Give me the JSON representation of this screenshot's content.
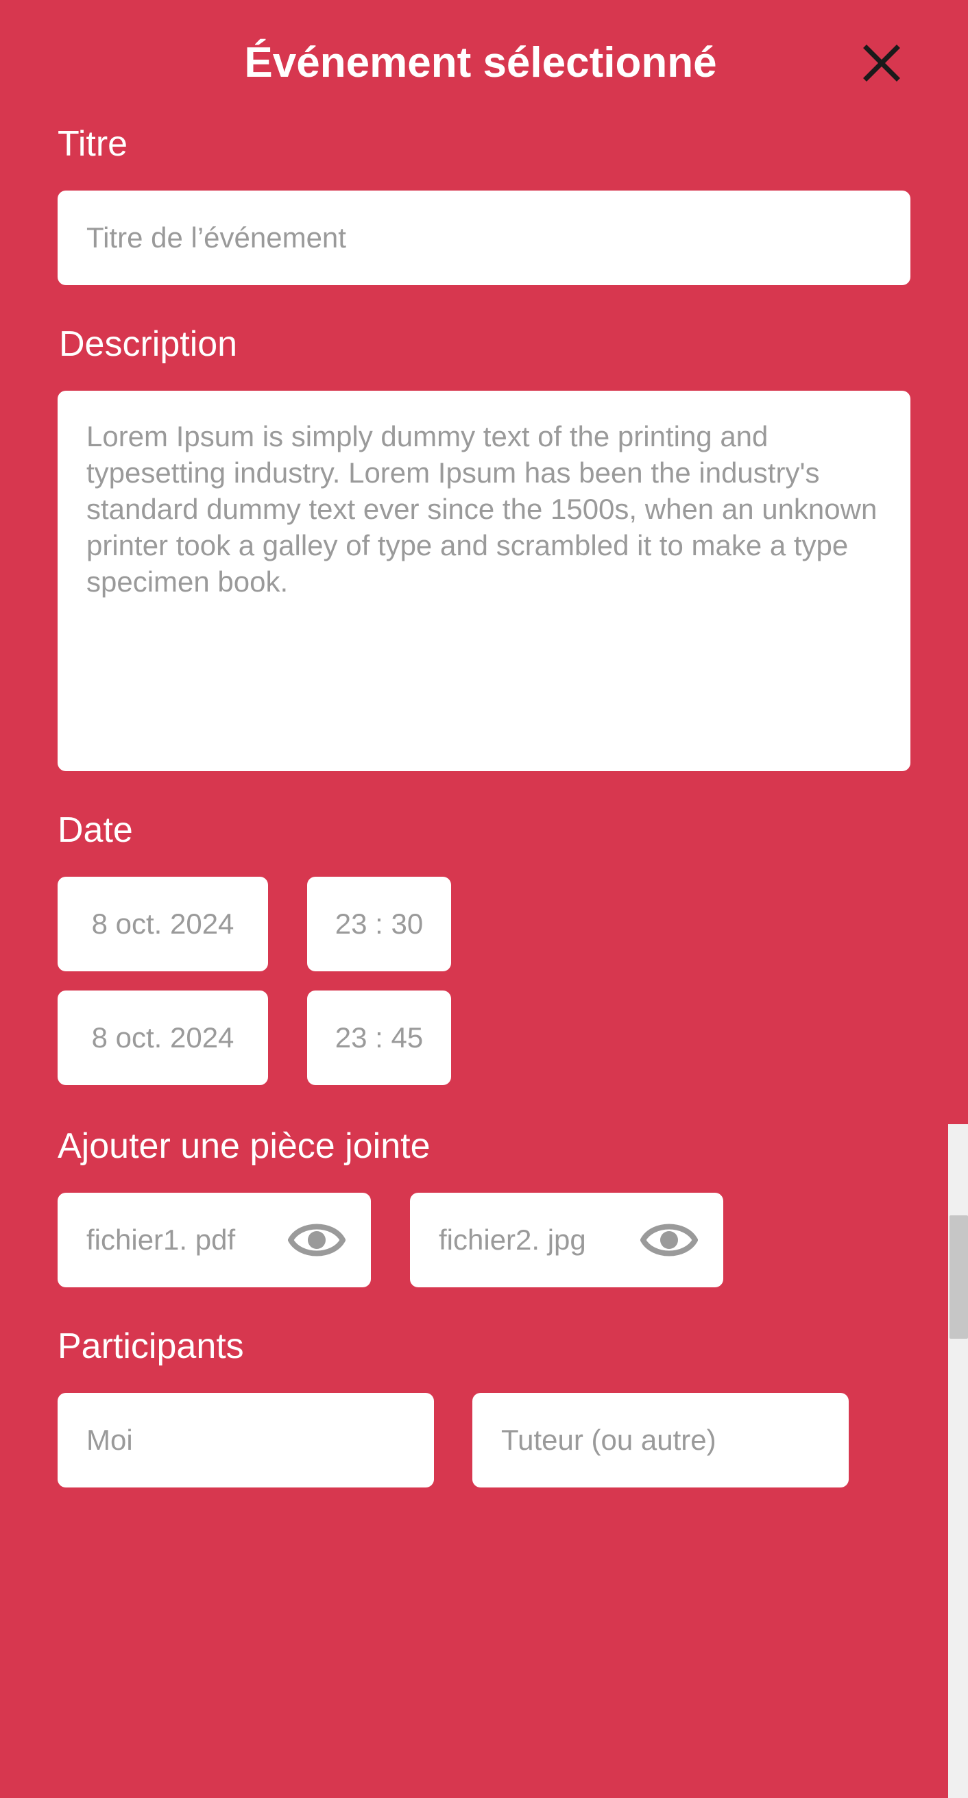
{
  "header": {
    "title": "Événement sélectionné",
    "close_icon": "close-icon"
  },
  "titre": {
    "label": "Titre",
    "placeholder": "Titre de l’événement"
  },
  "description": {
    "label": "Description",
    "value": "Lorem Ipsum is simply dummy text of the printing and typesetting industry. Lorem Ipsum has been the industry's standard dummy text ever since the 1500s, when an unknown printer took a galley of  type and scrambled it to make a type specimen book."
  },
  "date": {
    "label": "Date",
    "start_date": "8 oct. 2024",
    "start_time": "23 : 30",
    "end_date": "8 oct. 2024",
    "end_time": "23 : 45"
  },
  "attachments": {
    "label": "Ajouter une pièce jointe",
    "files": [
      {
        "name": "fichier1. pdf",
        "icon": "eye-icon"
      },
      {
        "name": "fichier2. jpg",
        "icon": "eye-icon"
      }
    ]
  },
  "participants": {
    "label": "Participants",
    "items": [
      "Moi",
      "Tuteur (ou autre)"
    ]
  },
  "colors": {
    "background": "#D7374F",
    "field": "#FFFFFF",
    "field_text": "#9A9A9A",
    "label_text": "#FFFFFF"
  }
}
